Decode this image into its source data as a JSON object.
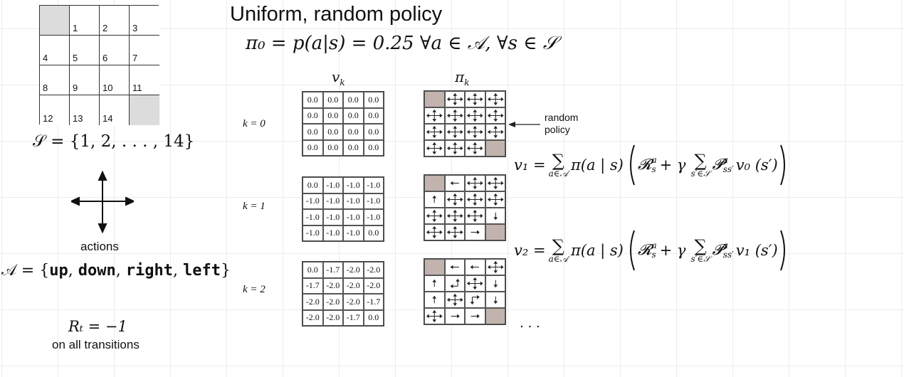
{
  "title": "Uniform, random policy",
  "policy_formula": "π₀ = p(a|s) = 0.25   ∀a ∈ 𝒜,  ∀s ∈ 𝒮",
  "gridworld": {
    "cells": [
      "",
      "1",
      "2",
      "3",
      "4",
      "5",
      "6",
      "7",
      "8",
      "9",
      "10",
      "11",
      "12",
      "13",
      "14",
      ""
    ],
    "terminal": [
      0,
      15
    ],
    "terminal_color": "#dcdcdc"
  },
  "states_set": "𝒮 = {1, 2, . . . , 14}",
  "actions_label": "actions",
  "actions_set_prefix": "𝒜 = {",
  "actions_set_items": [
    "up",
    "down",
    "right",
    "left"
  ],
  "actions_set_suffix": "}",
  "reward_formula": "Rₜ = −1",
  "reward_caption": "on all transitions",
  "value_header": "v",
  "value_header_sub": "k",
  "policy_header": "π",
  "policy_header_sub": "k",
  "random_policy_note": [
    "random",
    "policy"
  ],
  "ellipsis": ". . .",
  "iterations": [
    {
      "k_label": "k = 0",
      "values": [
        "0.0",
        "0.0",
        "0.0",
        "0.0",
        "0.0",
        "0.0",
        "0.0",
        "0.0",
        "0.0",
        "0.0",
        "0.0",
        "0.0",
        "0.0",
        "0.0",
        "0.0",
        "0.0"
      ],
      "policy": [
        "T",
        "udlr",
        "udlr",
        "udlr",
        "udlr",
        "udlr",
        "udlr",
        "udlr",
        "udlr",
        "udlr",
        "udlr",
        "udlr",
        "udlr",
        "udlr",
        "udlr",
        "T"
      ]
    },
    {
      "k_label": "k = 1",
      "values": [
        "0.0",
        "-1.0",
        "-1.0",
        "-1.0",
        "-1.0",
        "-1.0",
        "-1.0",
        "-1.0",
        "-1.0",
        "-1.0",
        "-1.0",
        "-1.0",
        "-1.0",
        "-1.0",
        "-1.0",
        "0.0"
      ],
      "policy": [
        "T",
        "l",
        "udlr",
        "udlr",
        "u",
        "udlr",
        "udlr",
        "udlr",
        "udlr",
        "udlr",
        "udlr",
        "d",
        "udlr",
        "udlr",
        "r",
        "T"
      ]
    },
    {
      "k_label": "k = 2",
      "values": [
        "0.0",
        "-1.7",
        "-2.0",
        "-2.0",
        "-1.7",
        "-2.0",
        "-2.0",
        "-2.0",
        "-2.0",
        "-2.0",
        "-2.0",
        "-1.7",
        "-2.0",
        "-2.0",
        "-1.7",
        "0.0"
      ],
      "policy": [
        "T",
        "l",
        "l",
        "udlr",
        "u",
        "ul",
        "udlr",
        "d",
        "u",
        "udlr",
        "dr",
        "d",
        "udlr",
        "r",
        "r",
        "T"
      ]
    }
  ],
  "policy_terminal_color": "#c2b3af",
  "equations": [
    {
      "lhs": "v₁ = ",
      "sum_sub": "a∈𝒜",
      "body": "π(a | s)",
      "inner_sum_sub": "s′∈𝒮",
      "v_term": "v₀ (s′)"
    },
    {
      "lhs": "v₂ = ",
      "sum_sub": "a∈𝒜",
      "body": "π(a | s)",
      "inner_sum_sub": "s′∈𝒮",
      "v_term": "v₁ (s′)"
    }
  ]
}
